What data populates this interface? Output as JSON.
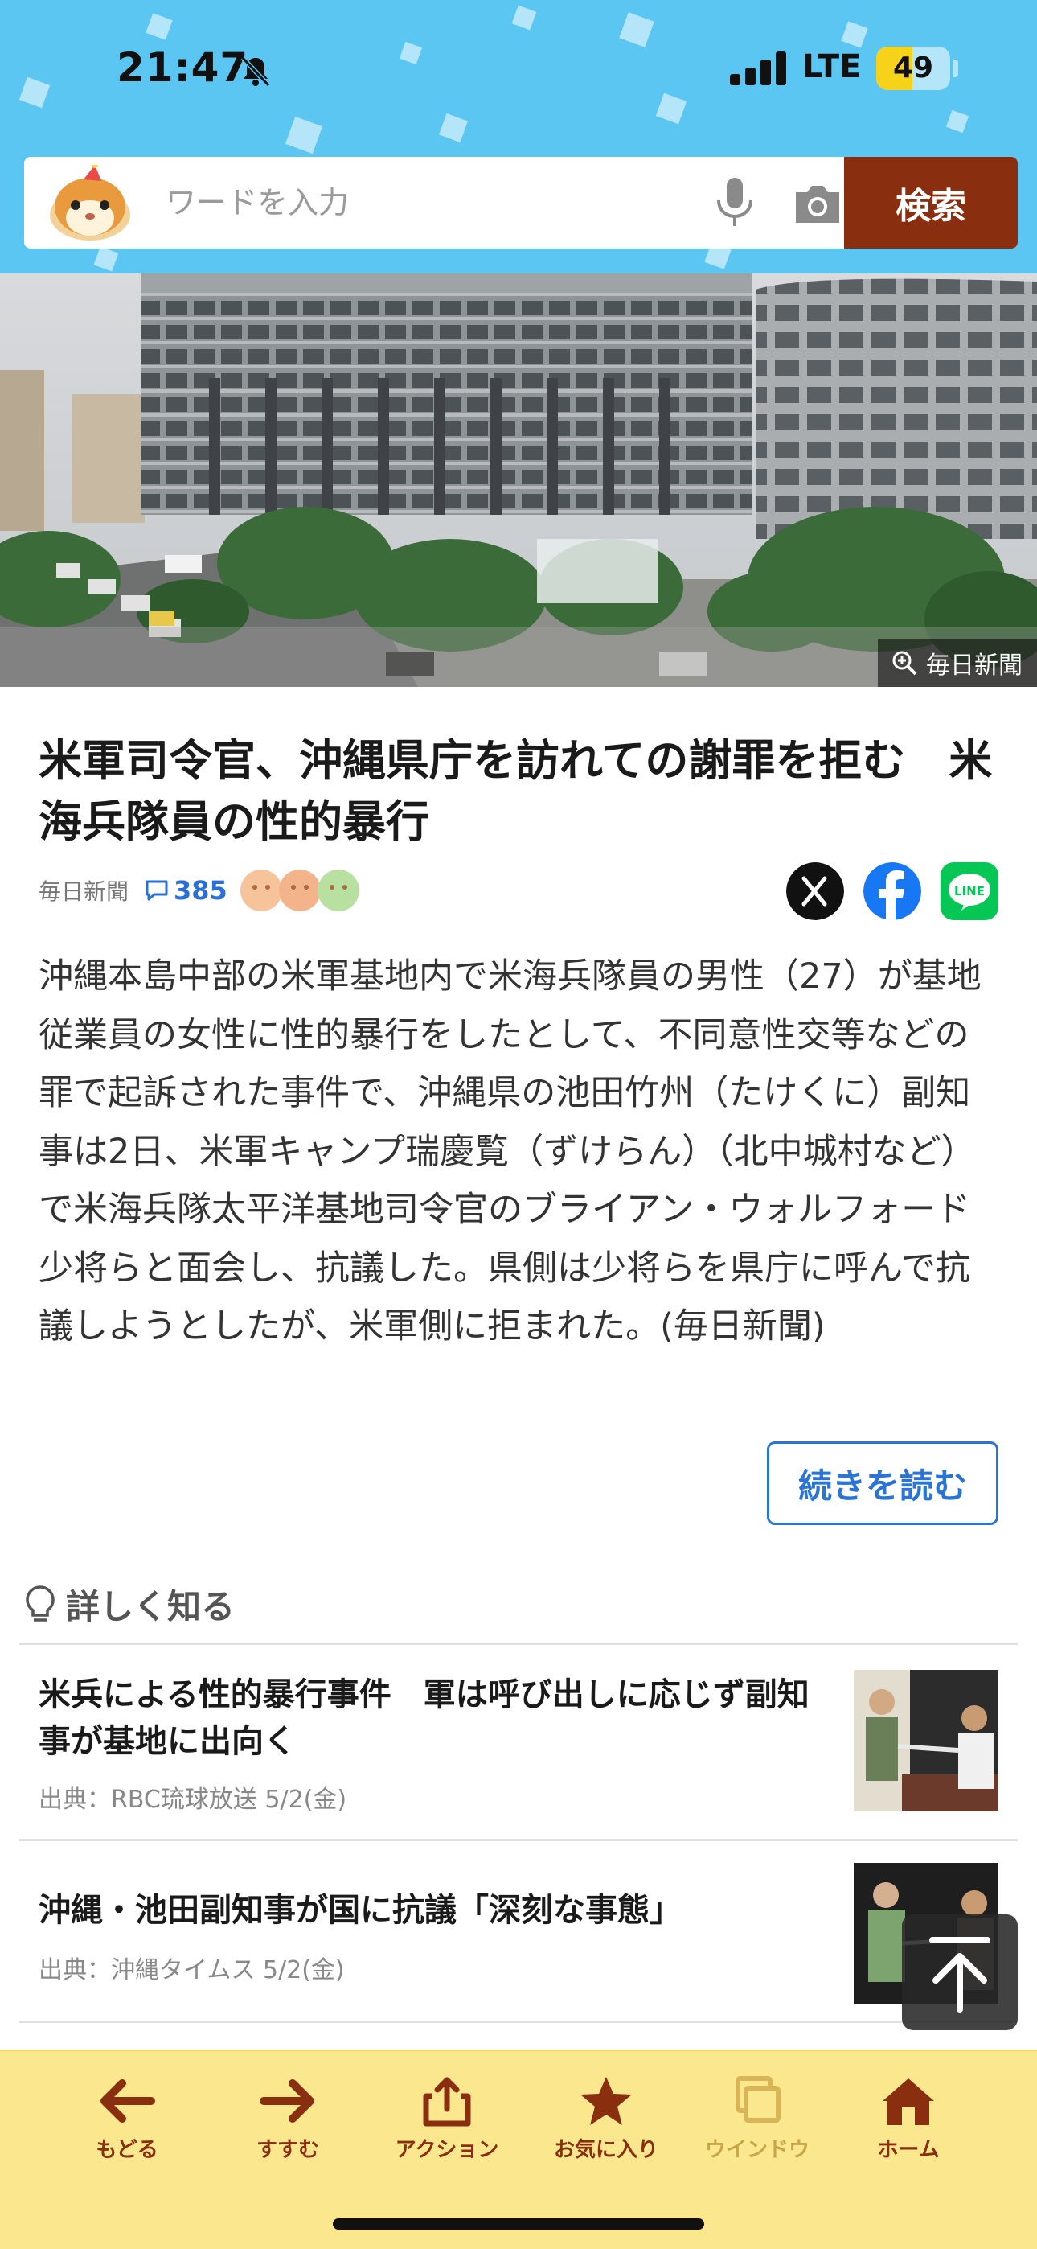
{
  "status_bar": {
    "time": "21:47",
    "network": "LTE",
    "battery": "49",
    "battery_level": 0.49
  },
  "search": {
    "placeholder": "ワードを入力",
    "button_label": "検索"
  },
  "hero": {
    "credit": "毎日新聞"
  },
  "article": {
    "title": "米軍司令官、沖縄県庁を訪れての謝罪を拒む　米海兵隊員の性的暴行",
    "source": "毎日新聞",
    "comment_count": "385",
    "body": "沖縄本島中部の米軍基地内で米海兵隊員の男性（27）が基地従業員の女性に性的暴行をしたとして、不同意性交等などの罪で起訴された事件で、沖縄県の池田竹州（たけくに）副知事は2日、米軍キャンプ瑞慶覧（ずけらん）（北中城村など）で米海兵隊太平洋基地司令官のブライアン・ウォルフォード少将らと面会し、抗議した。県側は少将らを県庁に呼んで抗議しようとしたが、米軍側に拒まれた。(毎日新聞)",
    "read_more_label": "続きを読む"
  },
  "related": {
    "heading": "詳しく知る",
    "items": [
      {
        "title": "米兵による性的暴行事件　軍は呼び出しに応じず副知事が基地に出向く",
        "source": "出典：RBC琉球放送 5/2(金)"
      },
      {
        "title": "沖縄・池田副知事が国に抗議「深刻な事態」",
        "source": "出典：沖縄タイムス 5/2(金)"
      }
    ]
  },
  "toolbar": {
    "items": [
      {
        "label": "もどる",
        "icon": "arrow-left-icon"
      },
      {
        "label": "すすむ",
        "icon": "arrow-right-icon"
      },
      {
        "label": "アクション",
        "icon": "share-icon"
      },
      {
        "label": "お気に入り",
        "icon": "star-icon"
      },
      {
        "label": "ウインドウ",
        "icon": "windows-icon"
      },
      {
        "label": "ホーム",
        "icon": "home-icon"
      }
    ]
  },
  "colors": {
    "header_bg": "#5cc6f2",
    "search_button": "#8a2e10",
    "link_blue": "#2a74d8",
    "toolbar_bg": "#fbe88e",
    "toolbar_icon": "#8a2e10"
  }
}
